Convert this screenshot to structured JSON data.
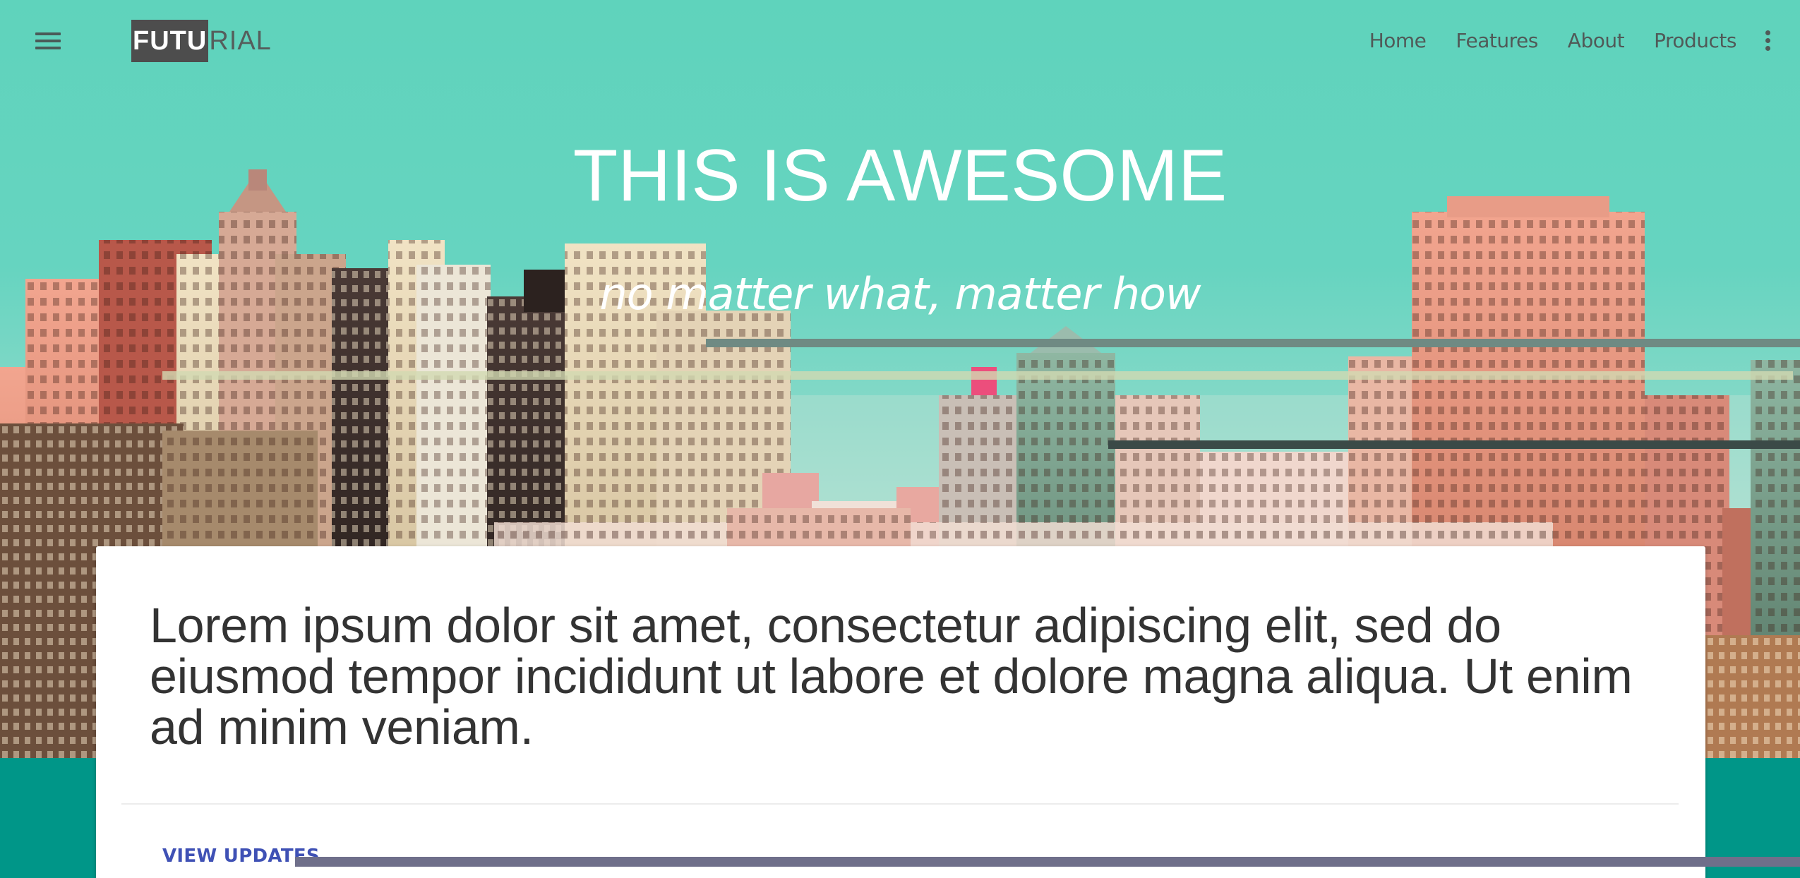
{
  "header": {
    "logo_highlight": "FUTU",
    "logo_rest": "RIAL",
    "nav": [
      {
        "label": "Home"
      },
      {
        "label": "Features"
      },
      {
        "label": "About"
      },
      {
        "label": "Products"
      }
    ],
    "menu_icon": "hamburger-icon",
    "more_icon": "more-vert-icon"
  },
  "hero": {
    "title": "THIS IS AWESOME",
    "subtitle": "no matter what, matter how"
  },
  "card": {
    "text": "Lorem ipsum dolor sit amet, consectetur adipiscing elit, sed do eiusmod tempor incididunt ut labore et dolore magna aliqua. Ut enim ad minim veniam.",
    "action_label": "VIEW UPDATES"
  },
  "colors": {
    "primary_teal": "#009688",
    "sky": "#5fd3bc",
    "accent_indigo": "#3f51b5",
    "logo_bg": "#4d4d4d"
  }
}
